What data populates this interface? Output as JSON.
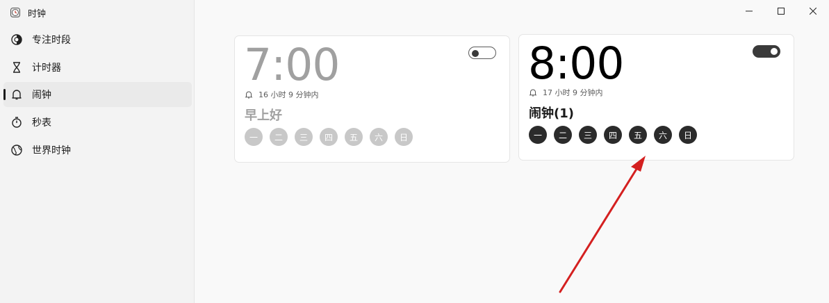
{
  "app": {
    "title": "时钟"
  },
  "sidebar": {
    "items": [
      {
        "label": "专注时段",
        "icon": "focus-icon"
      },
      {
        "label": "计时器",
        "icon": "hourglass-icon"
      },
      {
        "label": "闹钟",
        "icon": "bell-icon",
        "active": true
      },
      {
        "label": "秒表",
        "icon": "stopwatch-icon"
      },
      {
        "label": "世界时钟",
        "icon": "globe-icon"
      }
    ]
  },
  "alarms": [
    {
      "time": "7:00",
      "remaining": "16 小时 9 分钟内",
      "name": "早上好",
      "enabled": false,
      "days": [
        "一",
        "二",
        "三",
        "四",
        "五",
        "六",
        "日"
      ]
    },
    {
      "time": "8:00",
      "remaining": "17 小时 9 分钟内",
      "name": "闹钟(1)",
      "enabled": true,
      "days": [
        "一",
        "二",
        "三",
        "四",
        "五",
        "六",
        "日"
      ]
    }
  ],
  "colors": {
    "annotation_arrow": "#d42020",
    "accent": "#2b2b2b"
  }
}
